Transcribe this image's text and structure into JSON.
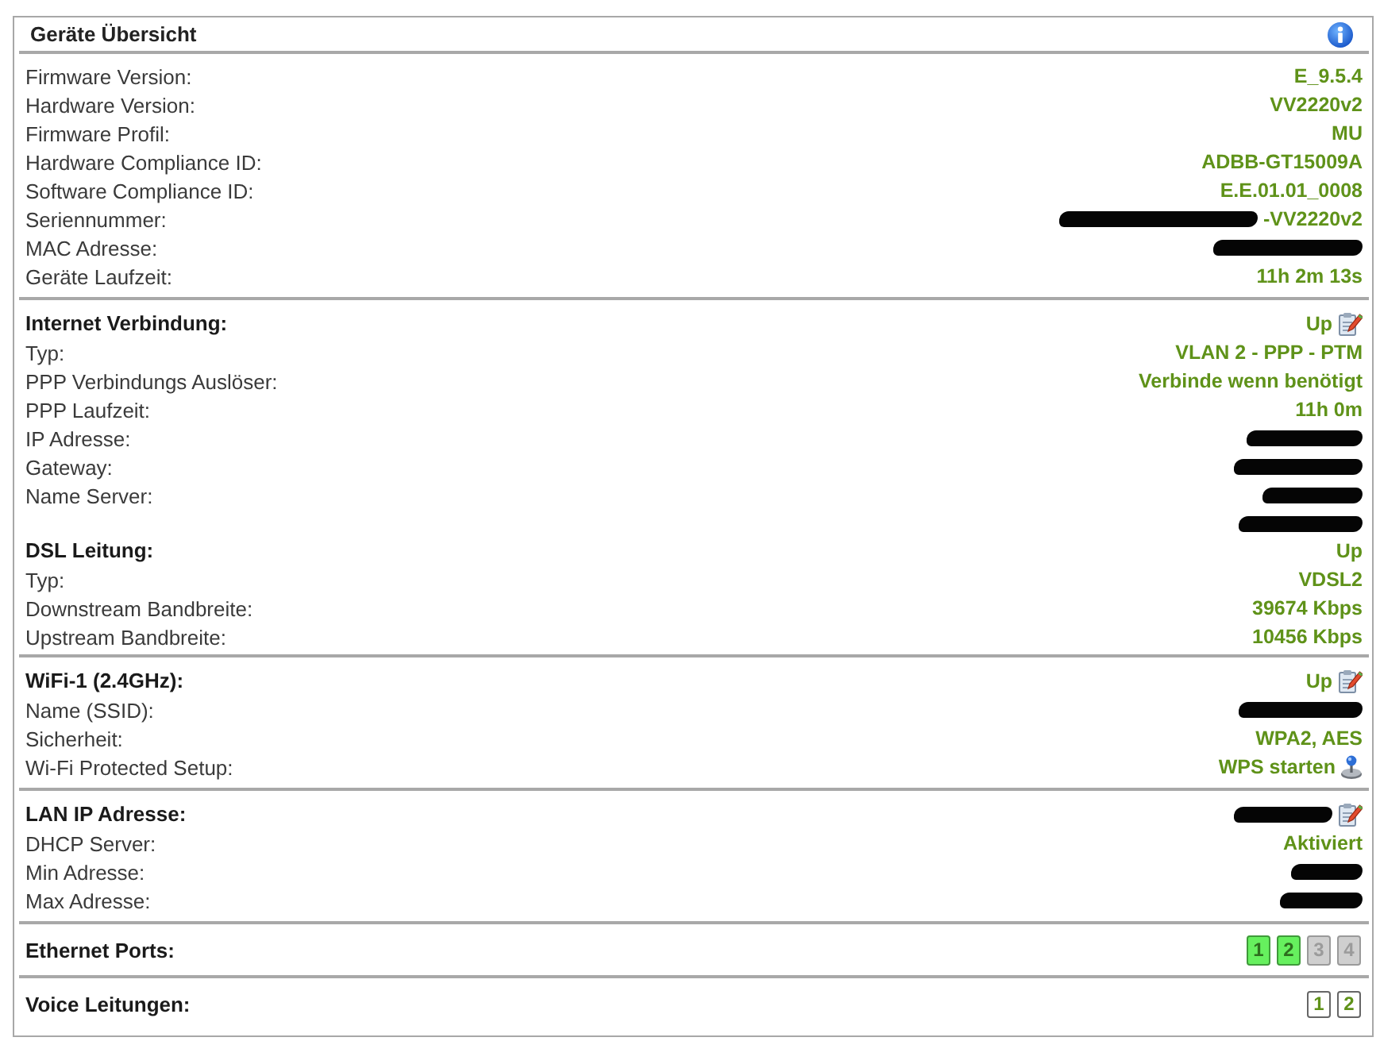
{
  "panel": {
    "title": "Geräte Übersicht"
  },
  "sections": [
    {
      "kind": "fields",
      "separated": true,
      "editable": false,
      "rows": [
        {
          "label": "Firmware Version:",
          "value": "E_9.5.4"
        },
        {
          "label": "Hardware Version:",
          "value": "VV2220v2"
        },
        {
          "label": "Firmware Profil:",
          "value": "MU"
        },
        {
          "label": "Hardware Compliance ID:",
          "value": "ADBB-GT15009A"
        },
        {
          "label": "Software Compliance ID:",
          "value": "E.E.01.01_0008"
        },
        {
          "label": "Seriennummer:",
          "value": "-VV2220v2",
          "redacted": true
        },
        {
          "label": "MAC Adresse:",
          "redacted": true
        },
        {
          "label": "Geräte Laufzeit:",
          "value": "11h 2m 13s"
        }
      ]
    },
    {
      "kind": "fields",
      "separated": true,
      "heading": "Internet Verbindung:",
      "status": "Up",
      "editable": true,
      "rows": [
        {
          "label": "Typ:",
          "value": "VLAN 2 - PPP - PTM"
        },
        {
          "label": "PPP Verbindungs Auslöser:",
          "value": "Verbinde wenn benötigt"
        },
        {
          "label": "PPP Laufzeit:",
          "value": "11h 0m"
        },
        {
          "label": "IP Adresse:",
          "redacted": true
        },
        {
          "label": "Gateway:",
          "redacted": true
        },
        {
          "label": "Name Server:",
          "redacted": true
        },
        {
          "redacted": true
        }
      ]
    },
    {
      "kind": "fields",
      "separated": false,
      "heading": "DSL Leitung:",
      "status": "Up",
      "editable": false,
      "rows": [
        {
          "label": "Typ:",
          "value": "VDSL2"
        },
        {
          "label": "Downstream Bandbreite:",
          "value": "39674 Kbps"
        },
        {
          "label": "Upstream Bandbreite:",
          "value": "10456 Kbps"
        }
      ]
    },
    {
      "kind": "fields",
      "separated": true,
      "heading": "WiFi-1 (2.4GHz):",
      "status": "Up",
      "editable": true,
      "rows": [
        {
          "label": "Name (SSID):",
          "redacted": true
        },
        {
          "label": "Sicherheit:",
          "value": "WPA2, AES"
        },
        {
          "label": "Wi-Fi Protected Setup:",
          "value": "WPS starten",
          "launch_button": true
        }
      ]
    },
    {
      "kind": "fields",
      "separated": true,
      "heading": "LAN IP Adresse:",
      "redacted": true,
      "editable": true,
      "rows": [
        {
          "label": "DHCP Server:",
          "value": "Aktiviert"
        },
        {
          "label": "Min Adresse:",
          "redacted": true
        },
        {
          "label": "Max Adresse:",
          "redacted": true
        }
      ]
    },
    {
      "kind": "ethernet",
      "separated": true,
      "heading": "Ethernet Ports:",
      "ports": [
        {
          "label": "1",
          "active": true
        },
        {
          "label": "2",
          "active": true
        },
        {
          "label": "3",
          "active": false
        },
        {
          "label": "4",
          "active": false
        }
      ]
    },
    {
      "kind": "voice",
      "separated": true,
      "heading": "Voice Leitungen:",
      "ports": [
        {
          "label": "1"
        },
        {
          "label": "2"
        }
      ]
    }
  ]
}
